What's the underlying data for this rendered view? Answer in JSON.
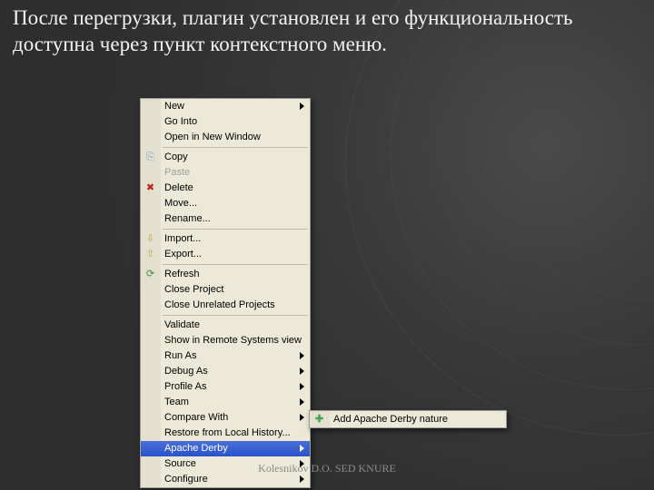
{
  "slide": {
    "heading": "После перегрузки, плагин установлен и его функциональность доступна через пункт контекстного меню.",
    "footer": "Kolesnikov D.O. SED KNURE"
  },
  "menu": {
    "groups": [
      [
        {
          "label": "New",
          "arrow": true
        },
        {
          "label": "Go Into"
        },
        {
          "label": "Open in New Window"
        }
      ],
      [
        {
          "label": "Copy",
          "icon": "copy"
        },
        {
          "label": "Paste",
          "disabled": true
        },
        {
          "label": "Delete",
          "icon": "delete"
        },
        {
          "label": "Move..."
        },
        {
          "label": "Rename..."
        }
      ],
      [
        {
          "label": "Import...",
          "icon": "import"
        },
        {
          "label": "Export...",
          "icon": "export"
        }
      ],
      [
        {
          "label": "Refresh",
          "icon": "refresh"
        },
        {
          "label": "Close Project"
        },
        {
          "label": "Close Unrelated Projects"
        }
      ],
      [
        {
          "label": "Validate"
        },
        {
          "label": "Show in Remote Systems view"
        },
        {
          "label": "Run As",
          "arrow": true
        },
        {
          "label": "Debug As",
          "arrow": true
        },
        {
          "label": "Profile As",
          "arrow": true
        },
        {
          "label": "Team",
          "arrow": true
        },
        {
          "label": "Compare With",
          "arrow": true
        },
        {
          "label": "Restore from Local History..."
        },
        {
          "label": "Apache Derby",
          "arrow": true,
          "selected": true
        },
        {
          "label": "Source",
          "arrow": true
        },
        {
          "label": "Configure",
          "arrow": true
        }
      ]
    ]
  },
  "submenu": {
    "items": [
      {
        "label": "Add Apache Derby nature",
        "icon": "plus"
      }
    ]
  }
}
